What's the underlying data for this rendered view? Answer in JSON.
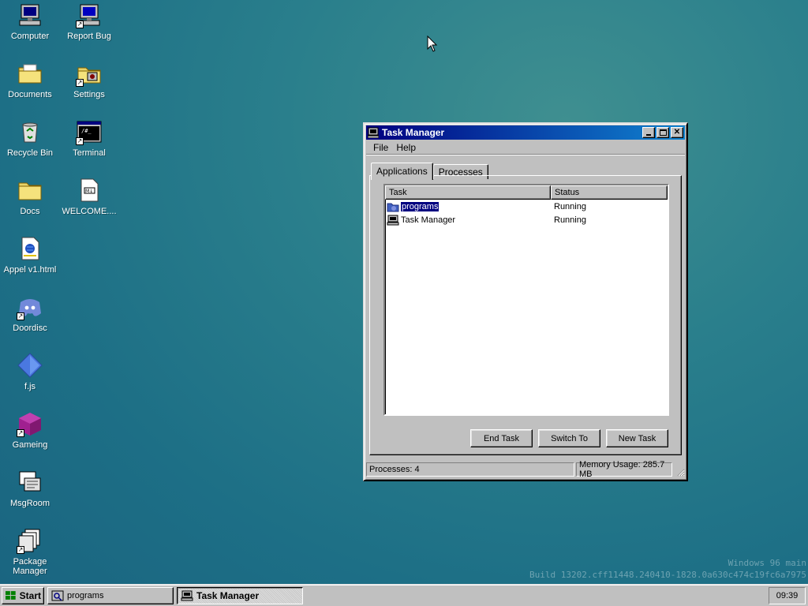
{
  "desktop": {
    "icons": [
      {
        "label": "Computer",
        "icon": "computer-icon"
      },
      {
        "label": "Report Bug",
        "icon": "report-bug-icon"
      },
      {
        "label": "Documents",
        "icon": "documents-folder-icon"
      },
      {
        "label": "Settings",
        "icon": "settings-folder-icon"
      },
      {
        "label": "Recycle Bin",
        "icon": "recycle-bin-icon"
      },
      {
        "label": "Terminal",
        "icon": "terminal-icon"
      },
      {
        "label": "Docs",
        "icon": "folder-icon"
      },
      {
        "label": "WELCOME....",
        "icon": "markdown-file-icon"
      },
      {
        "label": "Appel v1.html",
        "icon": "html-file-icon"
      },
      {
        "label": "Doordisc",
        "icon": "discord-icon"
      },
      {
        "label": "f.js",
        "icon": "js-file-icon"
      },
      {
        "label": "Gameing",
        "icon": "cube-icon"
      },
      {
        "label": "MsgRoom",
        "icon": "msgroom-icon"
      },
      {
        "label": "Package Manager",
        "icon": "package-manager-icon"
      }
    ]
  },
  "watermark": {
    "line1": "Windows 96 main",
    "line2": "Build 13202.cff11448.240410-1828.0a630c474c19fc6a7975"
  },
  "task_manager": {
    "title": "Task Manager",
    "menu": [
      "File",
      "Help"
    ],
    "tabs": [
      "Applications",
      "Processes"
    ],
    "active_tab": "Applications",
    "columns": [
      "Task",
      "Status"
    ],
    "rows": [
      {
        "task": "programs",
        "status": "Running",
        "selected": true
      },
      {
        "task": "Task Manager",
        "status": "Running",
        "selected": false
      }
    ],
    "buttons": {
      "end_task": "End Task",
      "switch_to": "Switch To",
      "new_task": "New Task"
    },
    "status": {
      "processes": "Processes: 4",
      "memory": "Memory Usage: 285.7 MB"
    }
  },
  "taskbar": {
    "start_label": "Start",
    "tasks": [
      {
        "label": "programs",
        "active": false
      },
      {
        "label": "Task Manager",
        "active": true
      }
    ],
    "clock": "09:39"
  },
  "colors": {
    "desktop_bg": "#2a7f8c",
    "title_active": "#000080",
    "selection": "#000080",
    "chrome": "#c0c0c0"
  }
}
